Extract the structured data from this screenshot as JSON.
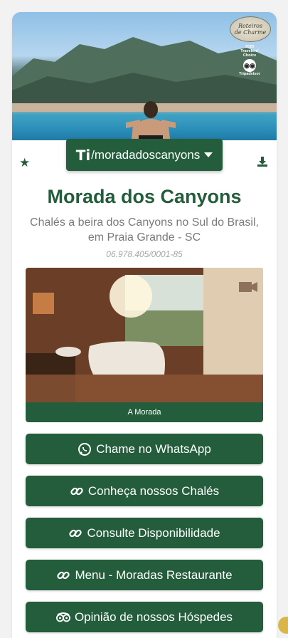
{
  "profile": {
    "handle": "/moradadoscanyons",
    "title": "Morada dos Canyons",
    "subtitle": "Chalés a beira dos Canyons no Sul do Brasil, em Praia Grande - SC",
    "cnpj": "06.978.405/0001-85"
  },
  "badges": {
    "charme_line1": "Roteiros",
    "charme_line2": "de Charme",
    "tc_year": "2020",
    "tc_line1": "Travelers'",
    "tc_line2": "Choice",
    "tc_brand": "Tripadvisor"
  },
  "feature": {
    "caption": "A Morada"
  },
  "links": [
    {
      "label": "Chame no WhatsApp",
      "icon": "whatsapp-icon"
    },
    {
      "label": "Conheça nossos Chalés",
      "icon": "link-icon"
    },
    {
      "label": "Consulte Disponibilidade",
      "icon": "link-icon"
    },
    {
      "label": "Menu - Moradas Restaurante",
      "icon": "link-icon"
    },
    {
      "label": "Opinião de nossos Hóspedes",
      "icon": "tripadvisor-icon"
    }
  ],
  "colors": {
    "brand_green": "#245d3b",
    "title_green": "#245d3b",
    "subtitle_gray": "#7a7a7a",
    "background": "#f2f2f2"
  }
}
